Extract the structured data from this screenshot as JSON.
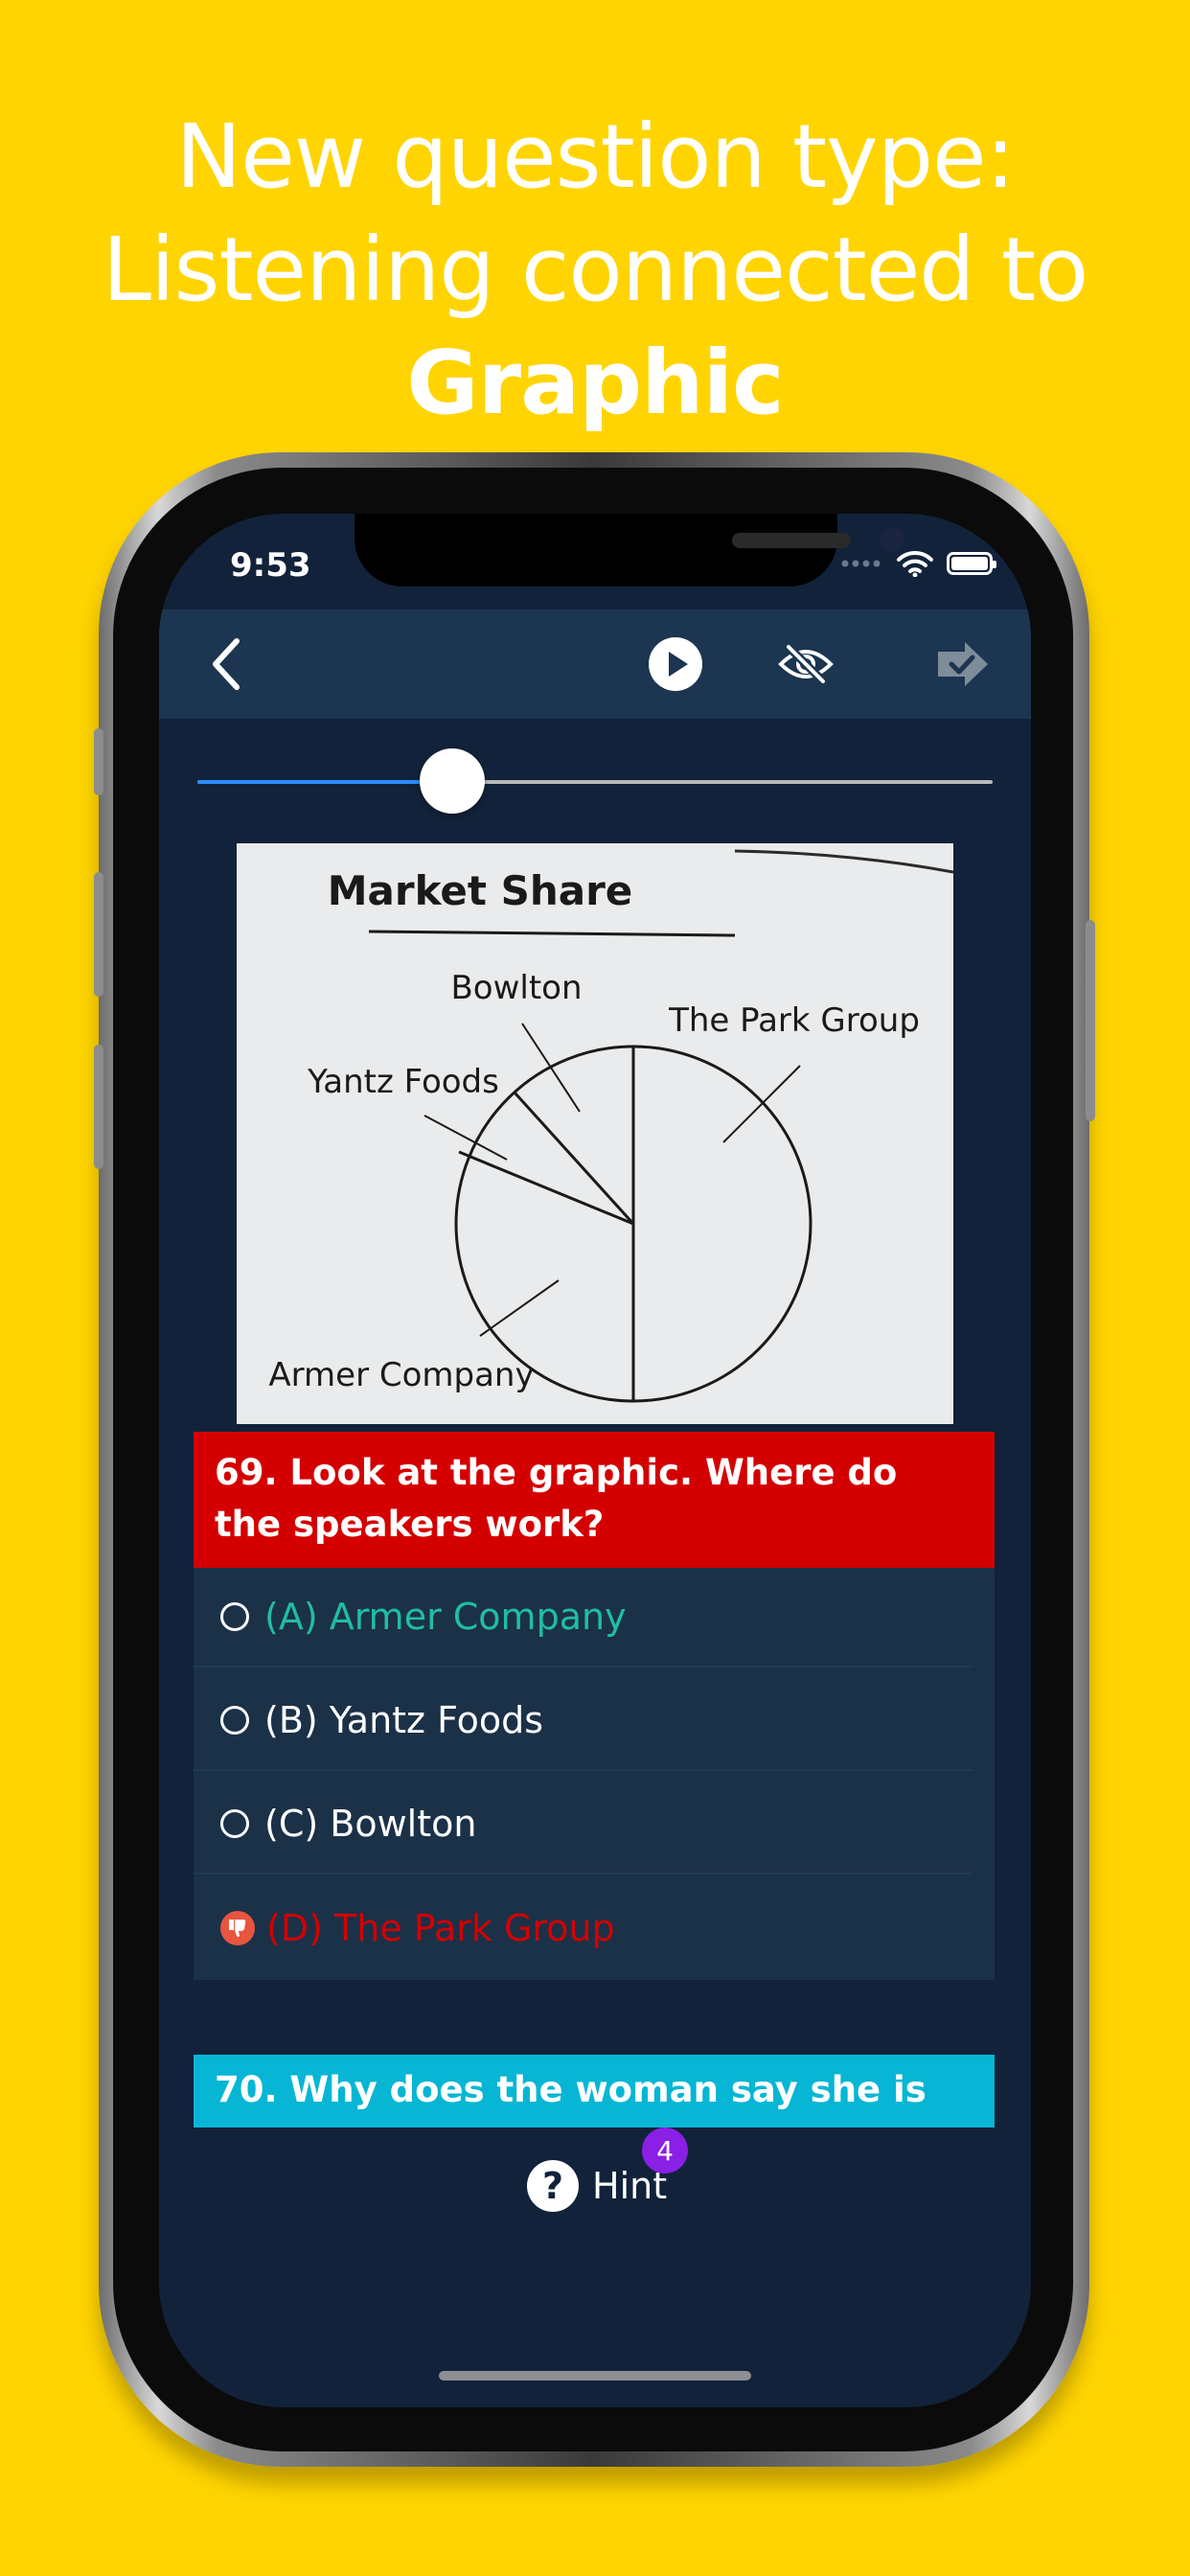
{
  "promo": {
    "line1": "New question type:",
    "line2_prefix": "Listening connected to ",
    "line2_bold": "Graphic"
  },
  "status_bar": {
    "time": "9:53"
  },
  "toolbar": {
    "back_icon": "chevron-left-icon",
    "play_icon": "play-icon",
    "hide_icon": "eye-slash-icon",
    "next_icon": "next-check-icon"
  },
  "audio": {
    "progress": 0.32
  },
  "graphic": {
    "title": "Market Share",
    "labels": {
      "bowlton": "Bowlton",
      "park_group": "The Park Group",
      "yantz": "Yantz Foods",
      "armer": "Armer Company"
    }
  },
  "question_69": {
    "text": "69. Look at the graphic. Where do the speakers work?",
    "options": [
      {
        "text": "(A) Armer Company",
        "state": "correct",
        "color": "#1fbfa0"
      },
      {
        "text": "(B) Yantz Foods",
        "state": "normal",
        "color": "#ffffff"
      },
      {
        "text": "(C) Bowlton",
        "state": "normal",
        "color": "#ffffff"
      },
      {
        "text": "(D) The Park Group",
        "state": "wrong",
        "color": "#d40000"
      }
    ]
  },
  "question_70": {
    "text": "70. Why does the woman say she is"
  },
  "hint": {
    "symbol": "?",
    "label": "Hint",
    "count": "4"
  },
  "colors": {
    "background": "#FFD400",
    "screen": "#11223a",
    "toolbar": "#1c3550",
    "q69_banner": "#d40000",
    "q70_banner": "#06b6d4",
    "badge": "#8a1fe6"
  }
}
